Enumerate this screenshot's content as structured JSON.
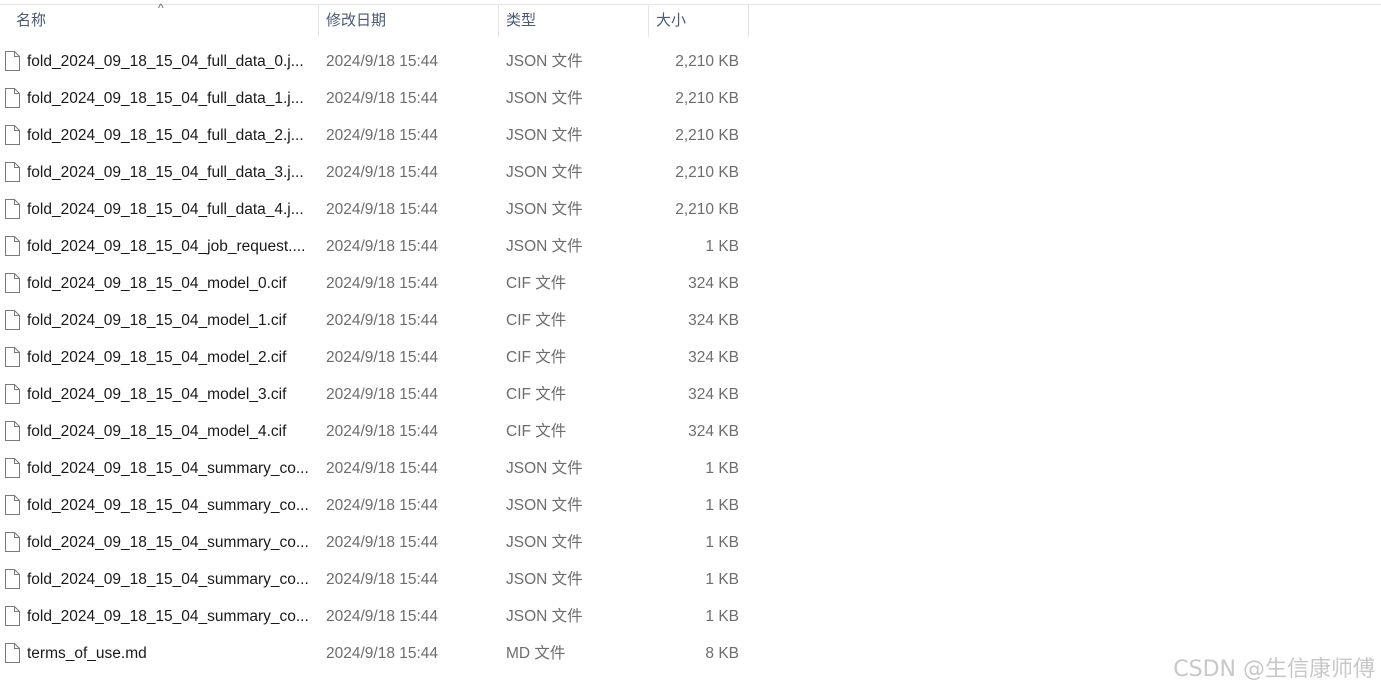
{
  "header": {
    "name_label": "名称",
    "date_label": "修改日期",
    "type_label": "类型",
    "size_label": "大小",
    "sort_arrow": "^"
  },
  "files": [
    {
      "name": "fold_2024_09_18_15_04_full_data_0.j...",
      "date": "2024/9/18 15:44",
      "type": "JSON 文件",
      "size": "2,210 KB",
      "icon": "file-icon"
    },
    {
      "name": "fold_2024_09_18_15_04_full_data_1.j...",
      "date": "2024/9/18 15:44",
      "type": "JSON 文件",
      "size": "2,210 KB",
      "icon": "file-icon"
    },
    {
      "name": "fold_2024_09_18_15_04_full_data_2.j...",
      "date": "2024/9/18 15:44",
      "type": "JSON 文件",
      "size": "2,210 KB",
      "icon": "file-icon"
    },
    {
      "name": "fold_2024_09_18_15_04_full_data_3.j...",
      "date": "2024/9/18 15:44",
      "type": "JSON 文件",
      "size": "2,210 KB",
      "icon": "file-icon"
    },
    {
      "name": "fold_2024_09_18_15_04_full_data_4.j...",
      "date": "2024/9/18 15:44",
      "type": "JSON 文件",
      "size": "2,210 KB",
      "icon": "file-icon"
    },
    {
      "name": "fold_2024_09_18_15_04_job_request....",
      "date": "2024/9/18 15:44",
      "type": "JSON 文件",
      "size": "1 KB",
      "icon": "file-icon"
    },
    {
      "name": "fold_2024_09_18_15_04_model_0.cif",
      "date": "2024/9/18 15:44",
      "type": "CIF 文件",
      "size": "324 KB",
      "icon": "file-icon"
    },
    {
      "name": "fold_2024_09_18_15_04_model_1.cif",
      "date": "2024/9/18 15:44",
      "type": "CIF 文件",
      "size": "324 KB",
      "icon": "file-icon"
    },
    {
      "name": "fold_2024_09_18_15_04_model_2.cif",
      "date": "2024/9/18 15:44",
      "type": "CIF 文件",
      "size": "324 KB",
      "icon": "file-icon"
    },
    {
      "name": "fold_2024_09_18_15_04_model_3.cif",
      "date": "2024/9/18 15:44",
      "type": "CIF 文件",
      "size": "324 KB",
      "icon": "file-icon"
    },
    {
      "name": "fold_2024_09_18_15_04_model_4.cif",
      "date": "2024/9/18 15:44",
      "type": "CIF 文件",
      "size": "324 KB",
      "icon": "file-icon"
    },
    {
      "name": "fold_2024_09_18_15_04_summary_co...",
      "date": "2024/9/18 15:44",
      "type": "JSON 文件",
      "size": "1 KB",
      "icon": "file-icon"
    },
    {
      "name": "fold_2024_09_18_15_04_summary_co...",
      "date": "2024/9/18 15:44",
      "type": "JSON 文件",
      "size": "1 KB",
      "icon": "file-icon"
    },
    {
      "name": "fold_2024_09_18_15_04_summary_co...",
      "date": "2024/9/18 15:44",
      "type": "JSON 文件",
      "size": "1 KB",
      "icon": "file-icon"
    },
    {
      "name": "fold_2024_09_18_15_04_summary_co...",
      "date": "2024/9/18 15:44",
      "type": "JSON 文件",
      "size": "1 KB",
      "icon": "file-icon"
    },
    {
      "name": "fold_2024_09_18_15_04_summary_co...",
      "date": "2024/9/18 15:44",
      "type": "JSON 文件",
      "size": "1 KB",
      "icon": "file-icon"
    },
    {
      "name": "terms_of_use.md",
      "date": "2024/9/18 15:44",
      "type": "MD 文件",
      "size": "8 KB",
      "icon": "file-icon"
    }
  ],
  "watermark": "CSDN @生信康师傅"
}
